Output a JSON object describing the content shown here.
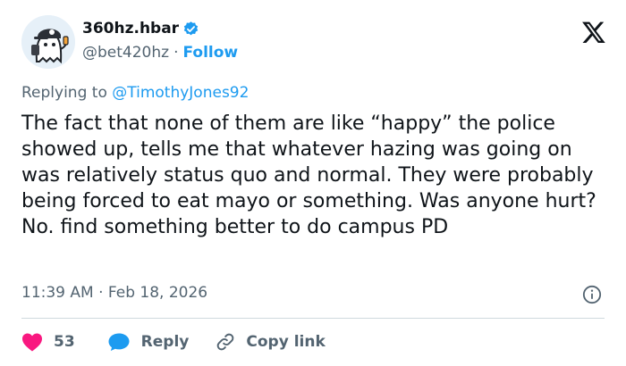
{
  "colors": {
    "accent": "#1d9bf0",
    "text": "#0f1419",
    "secondary": "#536471",
    "like": "#f91880",
    "divider": "#cfd9de"
  },
  "author": {
    "display_name": "360hz.hbar",
    "handle": "@bet420hz",
    "separator": "·",
    "follow_label": "Follow",
    "verified": true,
    "avatar_icon": "ghost-avatar"
  },
  "platform_icon": "x-logo-icon",
  "reply": {
    "prefix": "Replying to ",
    "mention": "@TimothyJones92"
  },
  "text": "The fact that none of them are like “happy” the police showed up, tells me that whatever hazing was going on was relatively status quo and normal. They were probably being forced to eat mayo or something. Was anyone hurt? No. find something better to do campus PD",
  "meta": {
    "timestamp": "11:39 AM · Feb 18, 2026",
    "info_icon": "info-icon"
  },
  "actions": {
    "like_count": "53",
    "reply_label": "Reply",
    "copy_label": "Copy link"
  }
}
